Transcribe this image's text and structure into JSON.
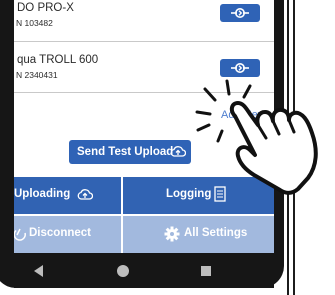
{
  "devices": [
    {
      "name": "DO PRO-X",
      "serial": "N 103482"
    },
    {
      "name": "qua TROLL 600",
      "serial": "N 2340431"
    }
  ],
  "add_new_label": "Add New",
  "send_test_upload_label": "Send Test Upload",
  "tiles": {
    "uploading": "Uploading",
    "logging": "Logging",
    "disconnect": "Disconnect",
    "all_settings": "All Settings"
  },
  "colors": {
    "primary": "#2f63b6",
    "tile_active": "#3163b3",
    "tile_muted": "#a2b9de",
    "link": "#4d7dcf"
  },
  "icons": [
    "connect-icon",
    "cloud-upload-icon",
    "document-icon",
    "power-icon",
    "gear-icon",
    "pointing-hand-icon"
  ]
}
